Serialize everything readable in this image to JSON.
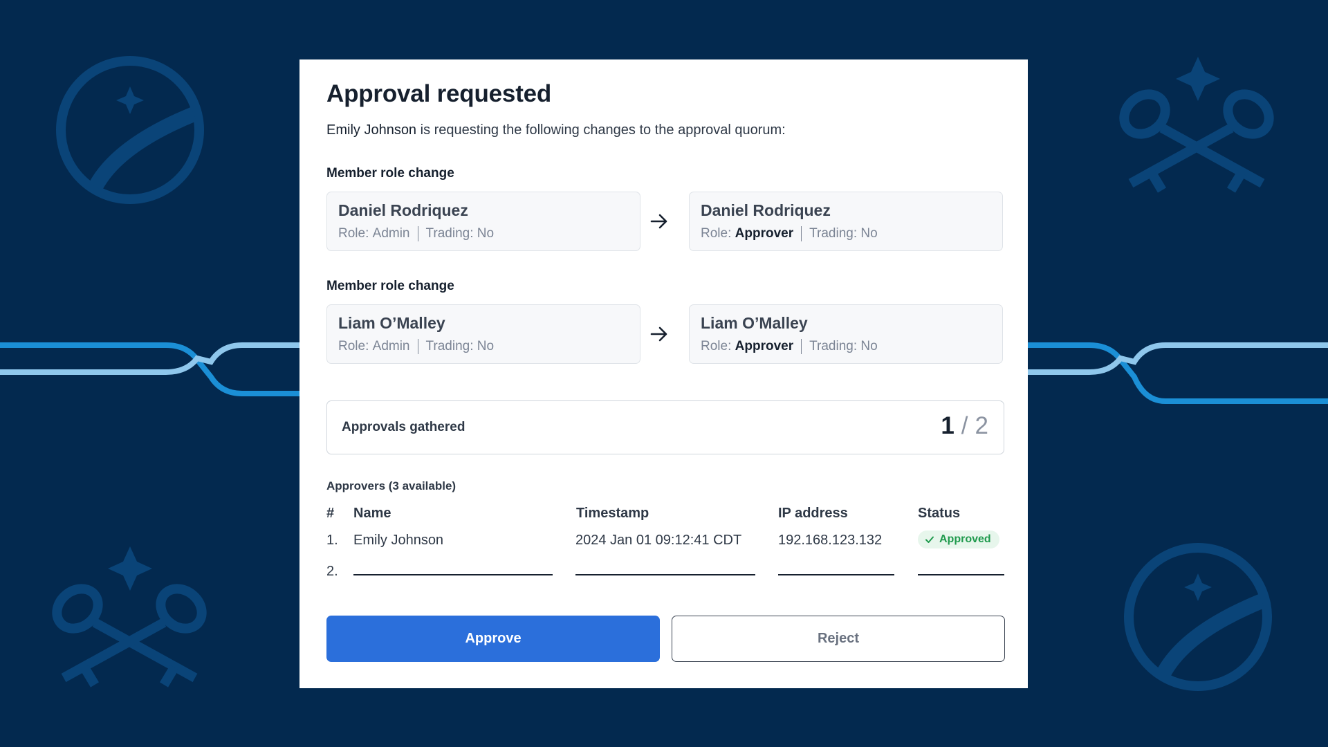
{
  "colors": {
    "background": "#03294f",
    "decor": "#0a4478",
    "line_bright": "#1b8fd6",
    "line_light": "#8fc7ec",
    "primary": "#2b6fdb",
    "success": "#1f9a4d"
  },
  "modal": {
    "title": "Approval requested",
    "requester": "Emily Johnson",
    "subtitle_rest": " is requesting the following changes to the approval quorum:",
    "changes": [
      {
        "label": "Member role change",
        "before": {
          "name": "Daniel Rodriquez",
          "role_label": "Role: ",
          "role": "Admin",
          "trading": "Trading: No"
        },
        "after": {
          "name": "Daniel Rodriquez",
          "role_label": "Role: ",
          "role": "Approver",
          "trading": "Trading: No"
        }
      },
      {
        "label": "Member role change",
        "before": {
          "name": "Liam O’Malley",
          "role_label": "Role: ",
          "role": "Admin",
          "trading": "Trading: No"
        },
        "after": {
          "name": "Liam O’Malley",
          "role_label": "Role: ",
          "role": "Approver",
          "trading": "Trading: No"
        }
      }
    ],
    "approvals": {
      "label": "Approvals gathered",
      "count": "1",
      "slash": "/",
      "total": "2"
    },
    "approvers": {
      "caption": "Approvers (3 available)",
      "headers": {
        "num": "#",
        "name": "Name",
        "timestamp": "Timestamp",
        "ip": "IP address",
        "status": "Status"
      },
      "rows": [
        {
          "num": "1.",
          "name": "Emily Johnson",
          "timestamp": "2024 Jan 01 09:12:41 CDT",
          "ip": "192.168.123.132",
          "status": "Approved"
        },
        {
          "num": "2."
        }
      ]
    },
    "buttons": {
      "approve": "Approve",
      "reject": "Reject"
    }
  },
  "icons": {
    "arrow": "arrow-right-icon",
    "check": "check-icon",
    "compass": "compass-emblem-icon",
    "keys": "crossed-keys-icon"
  }
}
